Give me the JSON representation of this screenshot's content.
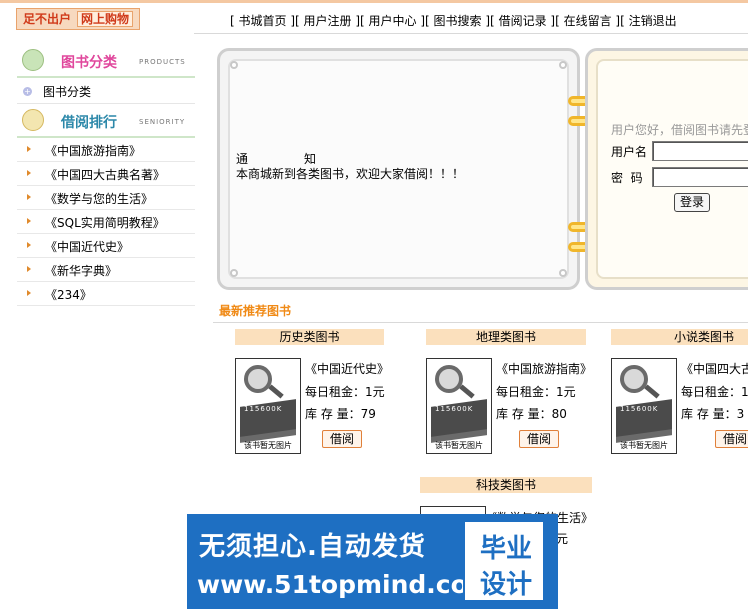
{
  "header": {
    "logo_left": "足不出户",
    "logo_right": "网上购物",
    "nav": [
      "书城首页",
      "用户注册",
      "用户中心",
      "图书搜索",
      "借阅记录",
      "在线留言",
      "注销退出"
    ]
  },
  "sidebar": {
    "products_title": "图书分类",
    "products_en": "PRODUCTS",
    "category_item": "图书分类",
    "ranking_title": "借阅排行",
    "ranking_en": "SENIORITY",
    "ranking_items": [
      "《中国旅游指南》",
      "《中国四大古典名著》",
      "《数学与您的生活》",
      "《SQL实用简明教程》",
      "《中国近代史》",
      "《新华字典》",
      "《234》"
    ]
  },
  "notice": {
    "title_left": "通",
    "title_right": "知",
    "body": "本商城新到各类图书，欢迎大家借阅！！！"
  },
  "login": {
    "hint": "用户您好，借阅图书请先登",
    "username_label": "用户名",
    "password_label": "密  码",
    "username_value": "",
    "password_value": "",
    "submit_label": "登录"
  },
  "recommend": {
    "title": "最新推荐图书",
    "cover_caption": "该书暂无图片",
    "cover_stack_text": "115600K",
    "categories": [
      {
        "name": "历史类图书",
        "book": "《中国近代史》",
        "rent": "每日租金：1元",
        "stock": "库 存 量：79",
        "borrow": "借阅"
      },
      {
        "name": "地理类图书",
        "book": "《中国旅游指南》",
        "rent": "每日租金：1元",
        "stock": "库 存 量：80",
        "borrow": "借阅"
      },
      {
        "name": "小说类图书",
        "book": "《中国四大古",
        "rent": "每日租金：1",
        "stock": "库 存 量：3",
        "borrow": "借阅"
      }
    ],
    "tech": {
      "name": "科技类图书",
      "book": "《数学与您的生活》",
      "rent": "元"
    }
  },
  "watermark": {
    "line1": "无须担心.自动发货",
    "line2": "www.51topmind.com",
    "badge_top": "毕业",
    "badge_bottom": "设计"
  }
}
